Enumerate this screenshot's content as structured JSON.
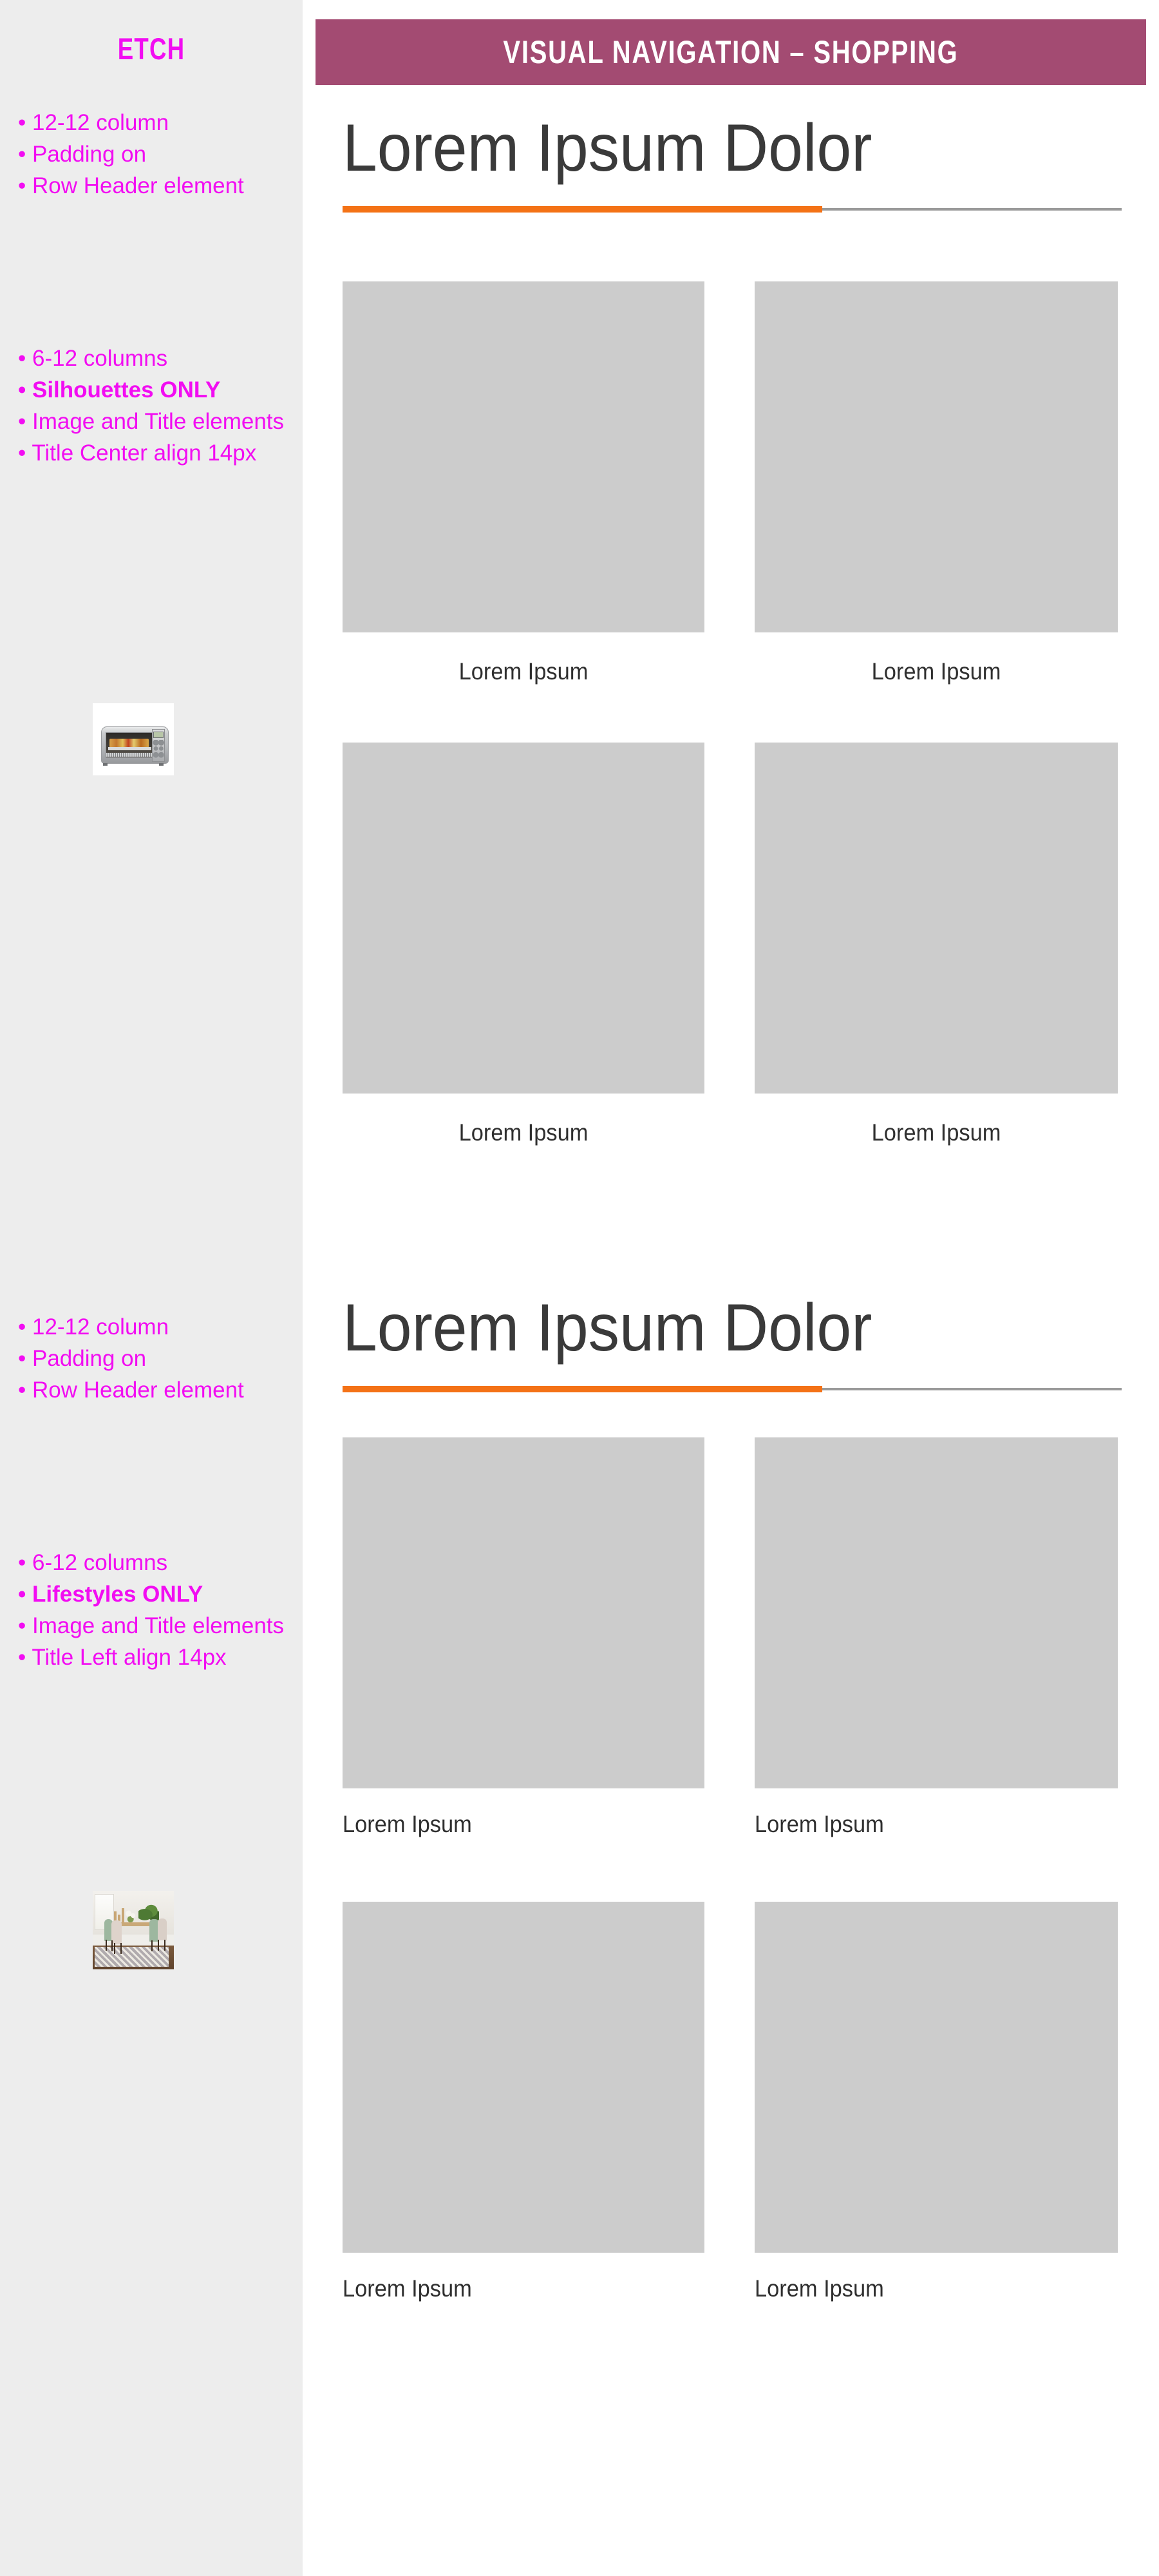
{
  "rail": {
    "logo": "ETCH",
    "blocks": [
      {
        "id": "row-header-notes-1",
        "lines": [
          {
            "text": "• 12-12 column",
            "bold": false
          },
          {
            "text": "• Padding on",
            "bold": false
          },
          {
            "text": "• Row Header element",
            "bold": false
          }
        ]
      },
      {
        "id": "silhouette-notes",
        "lines": [
          {
            "text": "• 6-12 columns",
            "bold": false
          },
          {
            "text": "• Silhouettes ONLY",
            "bold": true
          },
          {
            "text": "• Image and Title elements",
            "bold": false
          },
          {
            "text": "• Title Center align 14px",
            "bold": false
          }
        ]
      },
      {
        "id": "row-header-notes-2",
        "lines": [
          {
            "text": "• 12-12 column",
            "bold": false
          },
          {
            "text": "• Padding on",
            "bold": false
          },
          {
            "text": "• Row Header element",
            "bold": false
          }
        ]
      },
      {
        "id": "lifestyle-notes",
        "lines": [
          {
            "text": "• 6-12 columns",
            "bold": false
          },
          {
            "text": "• Lifestyles ONLY",
            "bold": true
          },
          {
            "text": "• Image and Title elements",
            "bold": false
          },
          {
            "text": "• Title Left align 14px",
            "bold": false
          }
        ]
      }
    ],
    "thumbnails": [
      {
        "id": "silhouette-sample",
        "description": "toaster oven product silhouette"
      },
      {
        "id": "lifestyle-sample",
        "description": "dining room lifestyle photo"
      }
    ]
  },
  "banner": {
    "title": "VISUAL NAVIGATION – SHOPPING",
    "background": "#a34b72",
    "text_color": "#ffffff"
  },
  "sections": [
    {
      "id": "silhouette-section",
      "heading": "Lorem Ipsum Dolor",
      "caption_align": "center",
      "tiles": [
        {
          "caption": "Lorem Ipsum"
        },
        {
          "caption": "Lorem Ipsum"
        },
        {
          "caption": "Lorem Ipsum"
        },
        {
          "caption": "Lorem Ipsum"
        }
      ]
    },
    {
      "id": "lifestyle-section",
      "heading": "Lorem Ipsum Dolor",
      "caption_align": "left",
      "tiles": [
        {
          "caption": "Lorem Ipsum"
        },
        {
          "caption": "Lorem Ipsum"
        },
        {
          "caption": "Lorem Ipsum"
        },
        {
          "caption": "Lorem Ipsum"
        }
      ]
    }
  ],
  "colors": {
    "rail_background": "#ededed",
    "annotation": "#f20df2",
    "banner": "#a34b72",
    "accent_orange": "#f47216",
    "rule_gray": "#9a9a9a",
    "tile_placeholder": "#cccccc",
    "heading_text": "#3a3a3a"
  }
}
